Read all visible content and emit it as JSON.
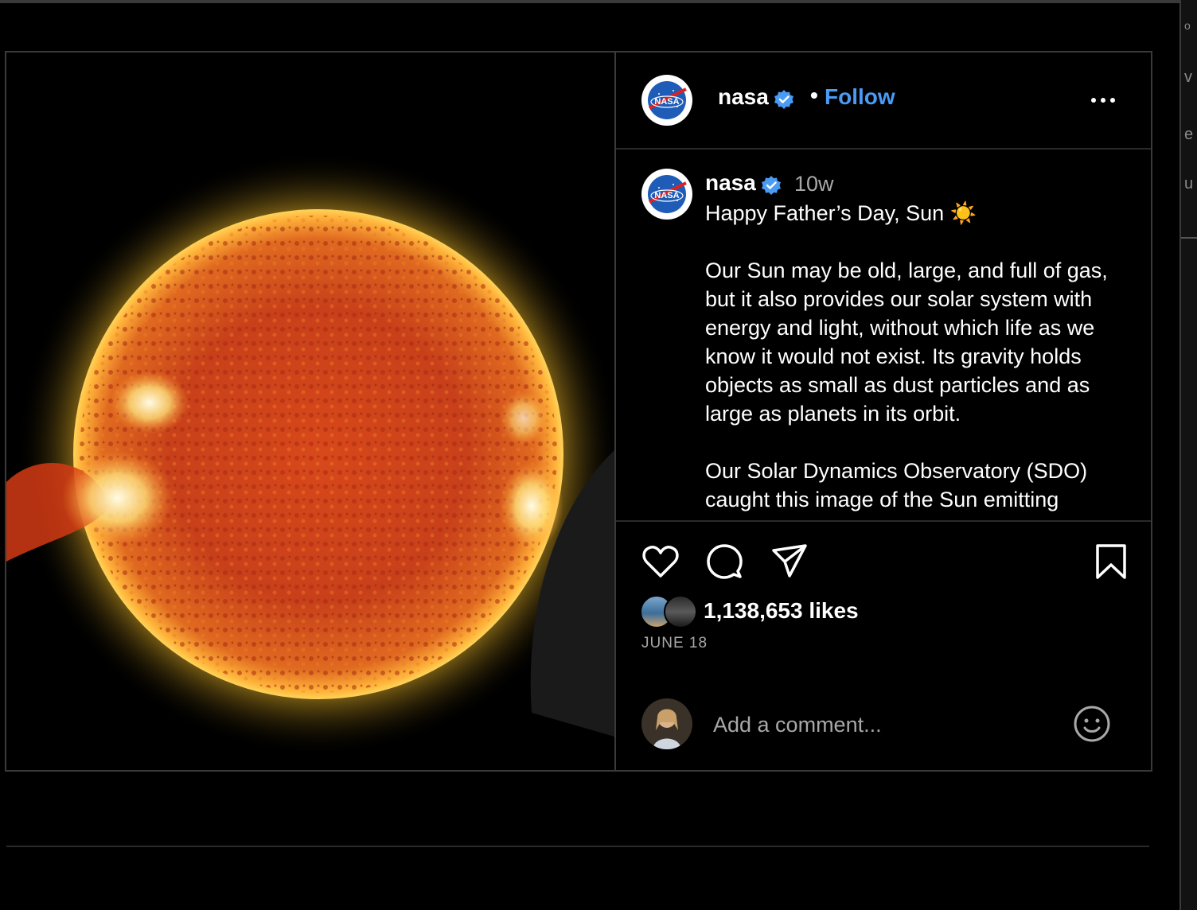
{
  "post": {
    "header": {
      "username": "nasa",
      "separator": "•",
      "follow_label": "Follow"
    },
    "caption": {
      "username": "nasa",
      "time_ago": "10w",
      "text": "Happy Father’s Day, Sun ☀️\n\nOur Sun may be old, large, and full of gas, but it also provides our solar system with energy and light, without which life as we know it would not exist. Its gravity holds objects as small as dust particles and as large as planets in its orbit.\n\nOur Solar Dynamics Observatory (SDO) caught this image of the Sun emitting"
    },
    "likes_label": "1,138,653 likes",
    "date_label": "JUNE 18",
    "comment": {
      "placeholder": "Add a comment..."
    },
    "icons": [
      "heart-icon",
      "comment-icon",
      "share-icon",
      "bookmark-icon",
      "more-icon",
      "emoji-icon",
      "verified-badge-icon"
    ]
  },
  "colors": {
    "background": "#000000",
    "accent": "#4a9bf5",
    "muted_text": "#a8a8a8",
    "border": "#3a3a3a"
  }
}
